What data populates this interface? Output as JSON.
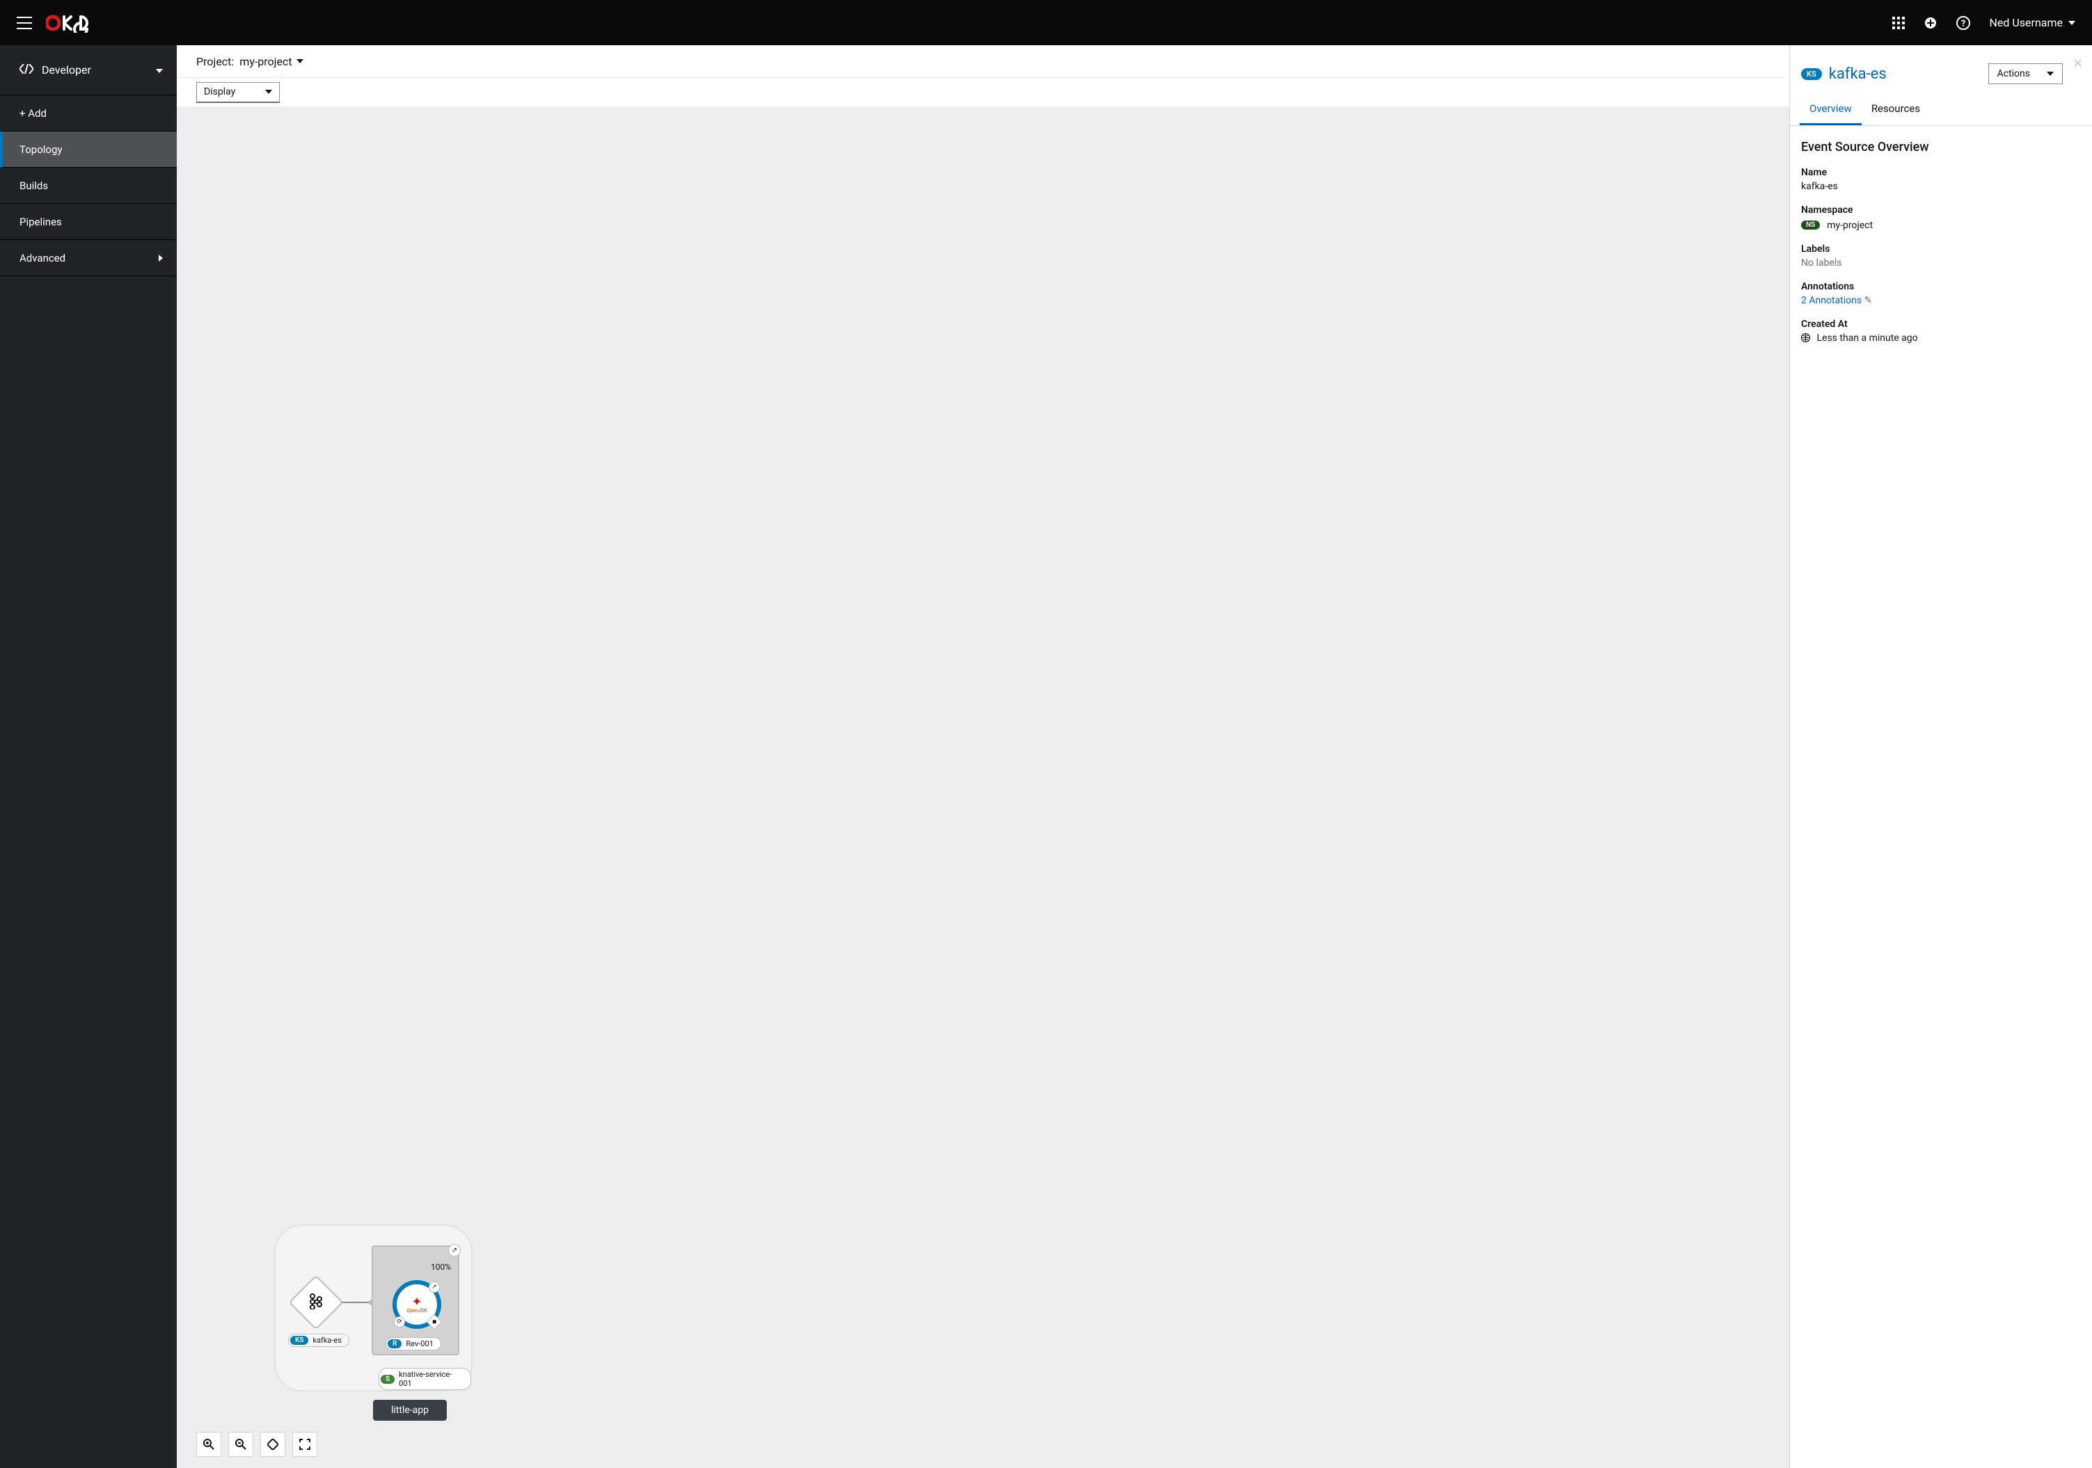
{
  "header": {
    "user": "Ned Username"
  },
  "sidebar": {
    "perspective": "Developer",
    "items": [
      "+ Add",
      "Topology",
      "Builds",
      "Pipelines",
      "Advanced"
    ],
    "active": "Topology"
  },
  "project": {
    "label": "Project:",
    "value": "my-project"
  },
  "display_label": "Display",
  "topology": {
    "app_group": "little-app",
    "kafka_badge": "KS",
    "kafka_label": "kafka-es",
    "ksvc_badge": "S",
    "ksvc_label": "knative-service-001",
    "rev_badge": "R",
    "rev_label": "Rev-001",
    "percent": "100%",
    "ojdk_line1": "Open",
    "ojdk_line2": "JDK"
  },
  "panel": {
    "badge": "KS",
    "title": "kafka-es",
    "actions_label": "Actions",
    "tabs": [
      "Overview",
      "Resources"
    ],
    "active_tab": "Overview",
    "heading": "Event Source Overview",
    "fields": {
      "name_k": "Name",
      "name_v": "kafka-es",
      "namespace_k": "Namespace",
      "namespace_badge": "NS",
      "namespace_v": "my-project",
      "labels_k": "Labels",
      "labels_v": "No labels",
      "annotations_k": "Annotations",
      "annotations_v": "2 Annotations",
      "created_k": "Created At",
      "created_v": "Less than a minute ago"
    }
  }
}
